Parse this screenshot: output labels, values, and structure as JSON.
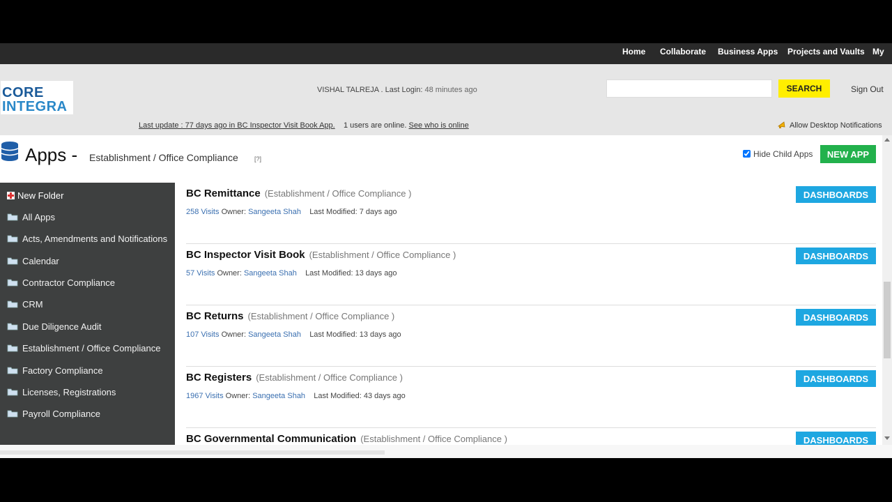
{
  "topnav": {
    "items": [
      {
        "label": "Home"
      },
      {
        "label": "Collaborate"
      },
      {
        "label": "Business Apps"
      },
      {
        "label": "Projects and Vaults"
      },
      {
        "label": "My"
      }
    ]
  },
  "header": {
    "logo_line1": "CORE",
    "logo_line2": "INTEGRA",
    "user_name": "VISHAL TALREJA",
    "last_login_label": ". Last Login:",
    "last_login_value": "48 minutes ago",
    "search_placeholder": "",
    "search_label": "SEARCH",
    "sign_out": "Sign Out",
    "last_update_link": "Last update : 77 days ago in BC Inspector Visit Book App.",
    "users_online": "1 users are online.",
    "see_who_link": "See who is online",
    "notifications": "Allow Desktop Notifications"
  },
  "apps_header": {
    "title": "Apps -",
    "breadcrumb": "Establishment / Office Compliance",
    "help": "[?]",
    "hide_child_label": "Hide Child Apps",
    "hide_child_checked": true,
    "new_app": "NEW APP"
  },
  "sidebar": {
    "new_folder": "New Folder",
    "folders": [
      {
        "label": "All Apps"
      },
      {
        "label": "Acts, Amendments and Notifications"
      },
      {
        "label": "Calendar"
      },
      {
        "label": "Contractor Compliance"
      },
      {
        "label": "CRM"
      },
      {
        "label": "Due Diligence Audit"
      },
      {
        "label": "Establishment / Office Compliance"
      },
      {
        "label": "Factory Compliance"
      },
      {
        "label": "Licenses, Registrations"
      },
      {
        "label": "Payroll Compliance"
      }
    ]
  },
  "apps": [
    {
      "name": "BC Remittance",
      "category": "(Establishment / Office Compliance )",
      "visits": "258 Visits",
      "owner_label": "Owner:",
      "owner": "Sangeeta Shah",
      "modified_label": "Last Modified:",
      "modified": "7 days ago",
      "button": "DASHBOARDS"
    },
    {
      "name": "BC Inspector Visit Book",
      "category": "(Establishment / Office Compliance )",
      "visits": "57 Visits",
      "owner_label": "Owner:",
      "owner": "Sangeeta Shah",
      "modified_label": "Last Modified:",
      "modified": "13 days ago",
      "button": "DASHBOARDS"
    },
    {
      "name": "BC Returns",
      "category": "(Establishment / Office Compliance )",
      "visits": "107 Visits",
      "owner_label": "Owner:",
      "owner": "Sangeeta Shah",
      "modified_label": "Last Modified:",
      "modified": "13 days ago",
      "button": "DASHBOARDS"
    },
    {
      "name": "BC Registers",
      "category": "(Establishment / Office Compliance )",
      "visits": "1967 Visits",
      "owner_label": "Owner:",
      "owner": "Sangeeta Shah",
      "modified_label": "Last Modified:",
      "modified": "43 days ago",
      "button": "DASHBOARDS"
    },
    {
      "name": "BC Governmental Communication",
      "category": "(Establishment / Office Compliance )",
      "visits": "",
      "owner_label": "",
      "owner": "",
      "modified_label": "",
      "modified": "",
      "button": "DASHBOARDS"
    }
  ],
  "colors": {
    "search_button": "#ffee00",
    "new_app_button": "#22b14c",
    "dashboards_button": "#1ea7e1",
    "sidebar_bg": "#3e4040",
    "topnav_bg": "#2a2a2a",
    "link": "#3a6fb0"
  },
  "icons": {
    "apps": "database-icon",
    "folder": "folder-icon",
    "new_folder": "plus-icon",
    "notifications": "bell-icon"
  }
}
